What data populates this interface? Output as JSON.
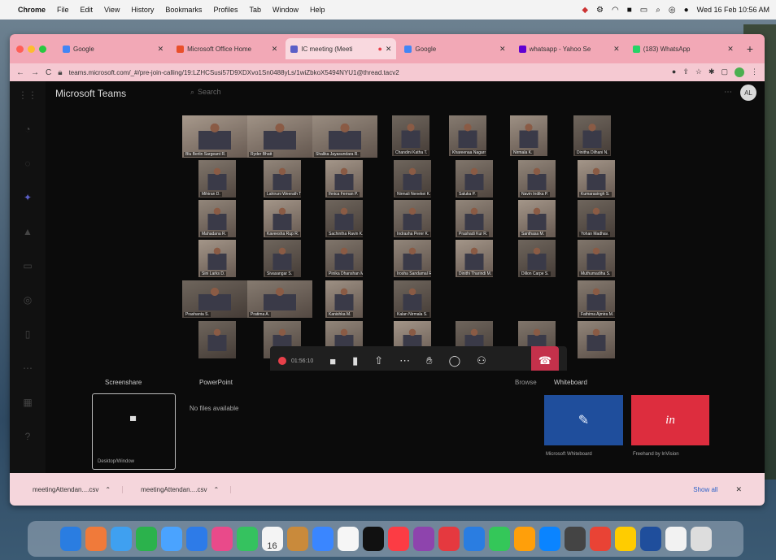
{
  "menubar": {
    "app": "Chrome",
    "menus": [
      "File",
      "Edit",
      "View",
      "History",
      "Bookmarks",
      "Profiles",
      "Tab",
      "Window",
      "Help"
    ],
    "clock": "Wed 16 Feb  10:56 AM"
  },
  "tabs": [
    {
      "label": "Google",
      "color": "#4285f4"
    },
    {
      "label": "Microsoft Office Home",
      "color": "#e94f2a"
    },
    {
      "label": "IC meeting (Meeti",
      "color": "#5b5fc7",
      "active": true
    },
    {
      "label": "Google",
      "color": "#4285f4"
    },
    {
      "label": "whatsapp - Yahoo Se",
      "color": "#6001d2"
    },
    {
      "label": "(183) WhatsApp",
      "color": "#25d366"
    }
  ],
  "url": "teams.microsoft.com/_#/pre-join-calling/19:LZHCSusi57D9XDXvo1Sn0488yLs/1wiZbkoX5494NYU1@thread.tacv2",
  "teams": {
    "app_title": "Microsoft Teams",
    "search_placeholder": "Search",
    "account_initials": "AL"
  },
  "call": {
    "elapsed": "01:56:10"
  },
  "gallery": {
    "large_tiles": [
      {
        "name": "Blu Berlin Sargeant R."
      },
      {
        "name": "Ryder Bhatt"
      },
      {
        "name": "Shalika Jayasundara R."
      }
    ],
    "grid_names": [
      [
        "Chandini Katha T.",
        "Khareenaa Nagarr M.",
        "Nirmala K.",
        "Dinitha Dilhani N."
      ],
      [
        "Mihiran D.",
        "Lahiruni Weerath T.",
        "Ihnica Fernan P.",
        "Nirmali Nenekei K.",
        "Saluka P.",
        "Navin Indika P.",
        "Kumarasingh S."
      ],
      [
        "Mahadana R.",
        "Kaveesha Rup R.",
        "Sachintha Ravin K.",
        "Indrasha Perer K.",
        "Prashadi Kur R.",
        "Santhasa M.",
        "Yohan Madhav."
      ],
      [
        "Sini Larks D.",
        "Sivasangar S.",
        "Pinika Dhanshan M.",
        "Irosha Sandamal R.",
        "Dinithi Tharindi M.",
        "Dillon Carpe S.",
        "Muthumadiha S."
      ],
      [
        "Prashanta S.",
        "Pratima A.",
        "Kanishka M.",
        "Kalan Nirmala S.",
        "Fathima Ajmira M."
      ],
      [
        "",
        "",
        "",
        "",
        "",
        "",
        ""
      ]
    ]
  },
  "share_tray": {
    "screenshare_label": "Screenshare",
    "powerpoint_label": "PowerPoint",
    "browse_label": "Browse",
    "whiteboard_label": "Whiteboard",
    "screenshare_tile_caption": "Desktop/Window",
    "no_files": "No files available",
    "whiteboard_options": [
      {
        "caption": "Microsoft Whiteboard",
        "glyph": "✎",
        "color": "#1f4e9c"
      },
      {
        "caption": "Freehand by InVision",
        "glyph": "in",
        "color": "#dd2d3e"
      }
    ]
  },
  "downloads": {
    "files": [
      "meetingAttendan....csv",
      "meetingAttendan....csv"
    ],
    "show_all": "Show all"
  },
  "dock": {
    "calendar_day": "16"
  }
}
